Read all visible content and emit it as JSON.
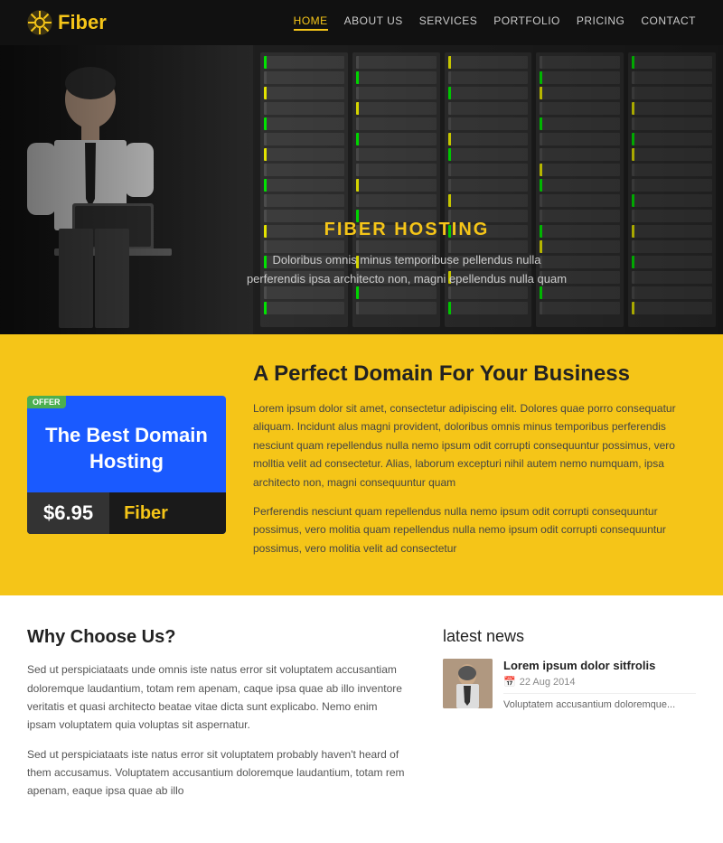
{
  "header": {
    "logo_text": "Fiber",
    "nav": [
      {
        "label": "HOME",
        "active": true
      },
      {
        "label": "ABOUT US",
        "active": false
      },
      {
        "label": "SERVICES",
        "active": false
      },
      {
        "label": "PORTFOLIO",
        "active": false
      },
      {
        "label": "PRICING",
        "active": false
      },
      {
        "label": "CONTACT",
        "active": false
      }
    ]
  },
  "hero": {
    "title": "FIBER HOSTING",
    "subtitle_line1": "Doloribus omnis minus temporibuse pellendus nulla",
    "subtitle_line2": "perferendis ipsa architecto non, magni epellendus nulla quam"
  },
  "offer": {
    "badge": "OFFER",
    "title": "The Best Domain Hosting",
    "price": "$6.95",
    "brand": "Fiber"
  },
  "domain": {
    "title": "A Perfect Domain For Your Business",
    "text1": "Lorem ipsum dolor sit amet, consectetur adipiscing elit. Dolores quae porro consequatur aliquam. Incidunt alus magni provident, doloribus omnis minus temporibus perferendis nesciunt quam repellendus nulla nemo ipsum odit corrupti consequuntur possimus, vero molltia velit ad consectetur. Alias, laborum excepturi nihil autem nemo numquam, ipsa architecto non, magni consequuntur quam",
    "text2": "Perferendis nesciunt quam repellendus nulla nemo ipsum odit corrupti consequuntur possimus, vero molitia quam repellendus nulla nemo ipsum odit corrupti consequuntur possimus, vero molitia velit ad consectetur"
  },
  "why_choose": {
    "title": "Why Choose Us?",
    "text1": "Sed ut perspiciataats unde omnis iste natus error sit voluptatem accusantiam doloremque laudantium, totam rem apenam, caque ipsa quae ab illo inventore veritatis et quasi architecto beatae vitae dicta sunt explicabo. Nemo enim ipsam voluptatem quia voluptas sit aspernatur.",
    "text2": "Sed ut perspiciataats iste natus error sit voluptatem probably haven't heard of them accusamus. Voluptatem accusantium doloremque laudantium, totam rem apenam, eaque ipsa quae ab illo"
  },
  "news": {
    "title": "latest news",
    "item": {
      "headline": "Lorem ipsum dolor sitfrolis",
      "date": "22 Aug 2014",
      "excerpt": "Voluptatem accusantium doloremque..."
    }
  }
}
